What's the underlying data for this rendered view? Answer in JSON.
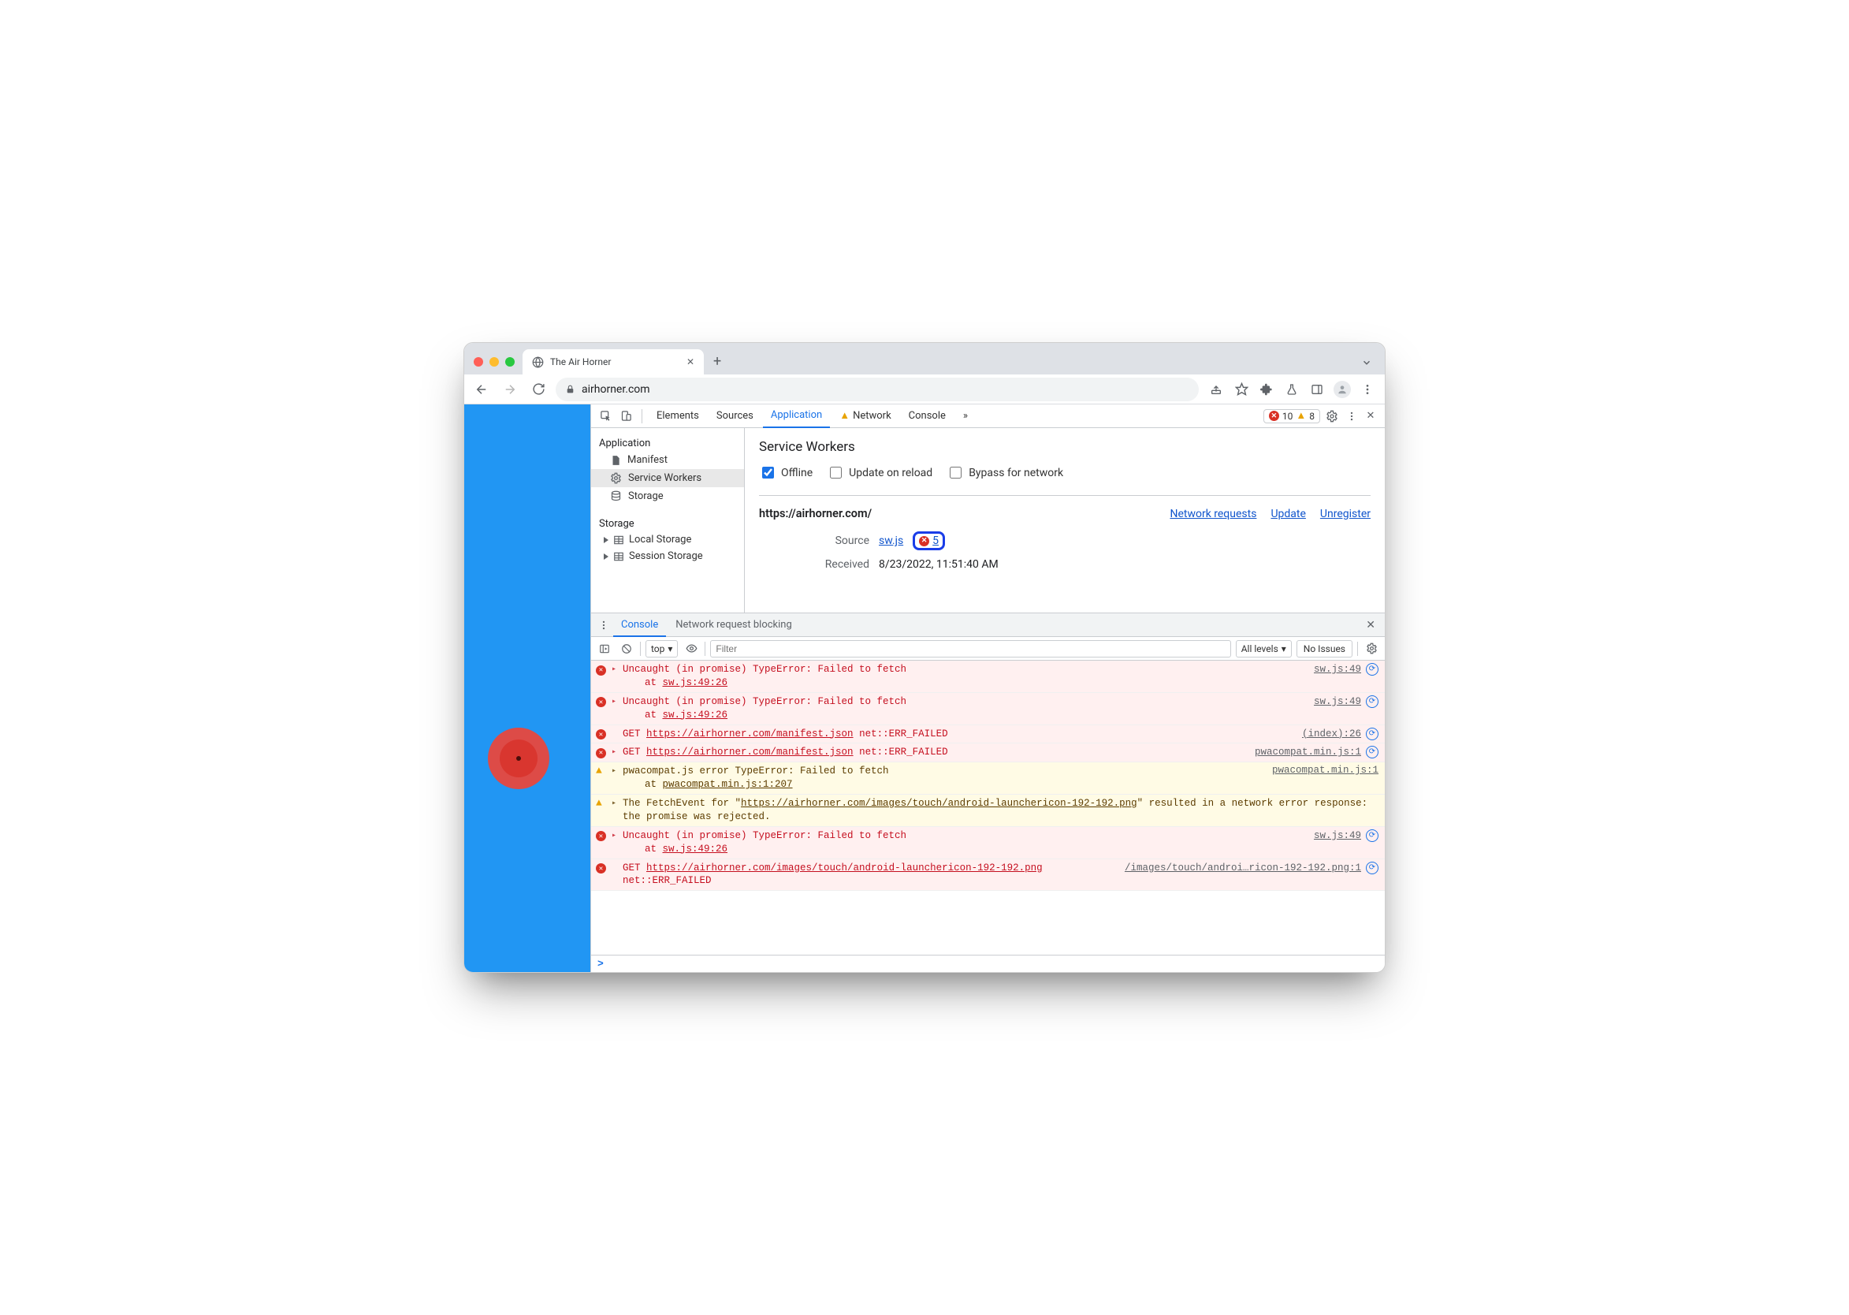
{
  "browser": {
    "tab_title": "The Air Horner",
    "url": "airhorner.com"
  },
  "devtools": {
    "tabs": [
      "Elements",
      "Sources",
      "Application",
      "Network",
      "Console"
    ],
    "active_tab": "Application",
    "network_has_warning": true,
    "error_count": "10",
    "warning_count": "8",
    "overflow_label": "»"
  },
  "app_panel": {
    "groups": [
      {
        "title": "Application",
        "items": [
          "Manifest",
          "Service Workers",
          "Storage"
        ],
        "selected": "Service Workers"
      },
      {
        "title": "Storage",
        "items": [
          "Local Storage",
          "Session Storage"
        ]
      }
    ],
    "sw": {
      "title": "Service Workers",
      "options": {
        "offline": {
          "label": "Offline",
          "checked": true
        },
        "update_on_reload": {
          "label": "Update on reload",
          "checked": false
        },
        "bypass": {
          "label": "Bypass for network",
          "checked": false
        }
      },
      "origin": "https://airhorner.com/",
      "links": {
        "network": "Network requests",
        "update": "Update",
        "unregister": "Unregister"
      },
      "source_label": "Source",
      "source_file": "sw.js",
      "source_error_count": "5",
      "received_label": "Received",
      "received_value": "8/23/2022, 11:51:40 AM"
    }
  },
  "drawer": {
    "tabs": [
      "Console",
      "Network request blocking"
    ],
    "active": "Console",
    "context": "top",
    "filter_placeholder": "Filter",
    "levels": "All levels",
    "issues": "No Issues"
  },
  "console": [
    {
      "type": "error",
      "expandable": true,
      "msg": "Uncaught (in promise) TypeError: Failed to fetch",
      "stack_at": "at ",
      "stack_link": "sw.js:49:26",
      "right_link": "sw.js:49",
      "spin": true
    },
    {
      "type": "error",
      "expandable": true,
      "msg": "Uncaught (in promise) TypeError: Failed to fetch",
      "stack_at": "at ",
      "stack_link": "sw.js:49:26",
      "right_link": "sw.js:49",
      "spin": true
    },
    {
      "type": "error",
      "expandable": false,
      "prefix": "GET ",
      "url": "https://airhorner.com/manifest.json",
      "suffix": " net::ERR_FAILED",
      "right_link": "(index):26",
      "spin": true
    },
    {
      "type": "error",
      "expandable": true,
      "prefix": "GET ",
      "url": "https://airhorner.com/manifest.json",
      "suffix": " net::ERR_FAILED",
      "right_link": "pwacompat.min.js:1",
      "spin": true
    },
    {
      "type": "warning",
      "expandable": true,
      "msg": "pwacompat.js error TypeError: Failed to fetch",
      "stack_at": "at ",
      "stack_link": "pwacompat.min.js:1:207",
      "right_link": "pwacompat.min.js:1",
      "spin": false
    },
    {
      "type": "warning",
      "expandable": true,
      "pre": "The FetchEvent for \"",
      "url": "https://airhorner.com/images/touch/android-launchericon-192-192.png",
      "post": "\" resulted in a network error response: the promise was rejected.",
      "right_link": "",
      "spin": false
    },
    {
      "type": "error",
      "expandable": true,
      "msg": "Uncaught (in promise) TypeError: Failed to fetch",
      "stack_at": "at ",
      "stack_link": "sw.js:49:26",
      "right_link": "sw.js:49",
      "spin": true
    },
    {
      "type": "error",
      "expandable": false,
      "prefix": "GET ",
      "url": "https://airhorner.com/images/touch/android-launchericon-192-192.png",
      "suffix": " net::ERR_FAILED",
      "right_link": "/images/touch/androi…ricon-192-192.png:1",
      "spin": true
    }
  ]
}
